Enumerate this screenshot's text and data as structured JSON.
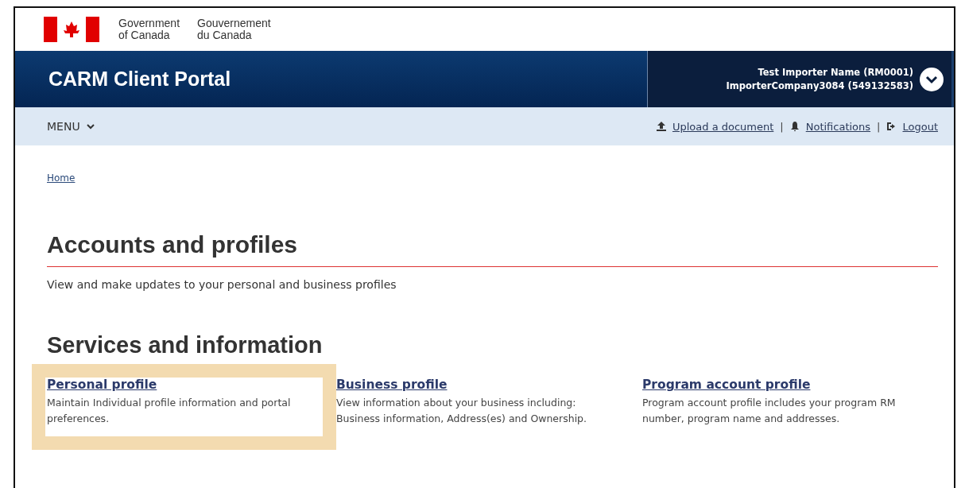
{
  "gov_header": {
    "name_en": [
      "Government",
      "of Canada"
    ],
    "name_fr": [
      "Gouvernement",
      "du Canada"
    ]
  },
  "banner": {
    "title": "CARM Client Portal",
    "user_lines": [
      "Test Importer Name (RM0001)",
      "ImporterCompany3084 (549132583)"
    ]
  },
  "menu_bar": {
    "menu": "MENU",
    "links": [
      {
        "kind": "upload",
        "label": "Upload a document"
      },
      {
        "kind": "bell",
        "label": "Notifications"
      },
      {
        "kind": "logout",
        "label": "Logout"
      }
    ],
    "separators": [
      "|",
      "|"
    ]
  },
  "breadcrumb": [
    "Home"
  ],
  "heading": "Accounts and profiles",
  "intro": "View and make updates to your personal and business profiles",
  "section_heading": "Services and information",
  "services": [
    {
      "title": "Personal profile",
      "description": "Maintain Individual profile information and portal preferences.",
      "highlighted": true
    },
    {
      "title": "Business profile",
      "description": "View information about your business including: Business information, Address(es) and Ownership.",
      "highlighted": false
    },
    {
      "title": "Program account profile",
      "description": "Program account profile includes your program RM number, program name and addresses.",
      "highlighted": false
    }
  ]
}
